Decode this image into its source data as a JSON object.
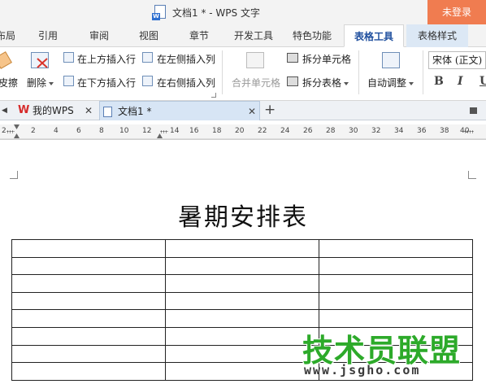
{
  "titlebar": {
    "title": "文档1 * - WPS 文字",
    "login_label": "未登录"
  },
  "menu": {
    "tabs": [
      "布局",
      "引用",
      "审阅",
      "视图",
      "章节",
      "开发工具",
      "特色功能",
      "表格工具",
      "表格样式"
    ],
    "active_tab": "表格工具"
  },
  "ribbon": {
    "erase_label": "皮擦",
    "delete_label": "删除",
    "insert_above": "在上方插入行",
    "insert_below": "在下方插入行",
    "insert_left": "在左侧插入列",
    "insert_right": "在右侧插入列",
    "merge_cells": "合并单元格",
    "split_cells": "拆分单元格",
    "split_table": "拆分表格",
    "auto_adjust": "自动调整",
    "font_name": "宋体 (正文)",
    "bold": "B",
    "italic": "I",
    "underline": "U"
  },
  "doc_tabs": {
    "home_tab": "我的WPS",
    "doc_tab": "文档1 *",
    "close_glyph": "✕",
    "add_glyph": "+"
  },
  "ruler": {
    "ticks": [
      "2",
      "2",
      "4",
      "6",
      "8",
      "10",
      "12",
      "14",
      "16",
      "18",
      "20",
      "22",
      "24",
      "26",
      "28",
      "30",
      "32",
      "34",
      "36",
      "38",
      "40"
    ]
  },
  "document": {
    "heading": "暑期安排表",
    "table": {
      "rows": 8,
      "cols": 3
    }
  },
  "watermark": {
    "brand": "技术员联盟",
    "url": "www.jsgho.com"
  },
  "colors": {
    "login_bg": "#f07c50",
    "active_tab_text": "#1f4f9e",
    "watermark_green": "#2daa2a"
  }
}
